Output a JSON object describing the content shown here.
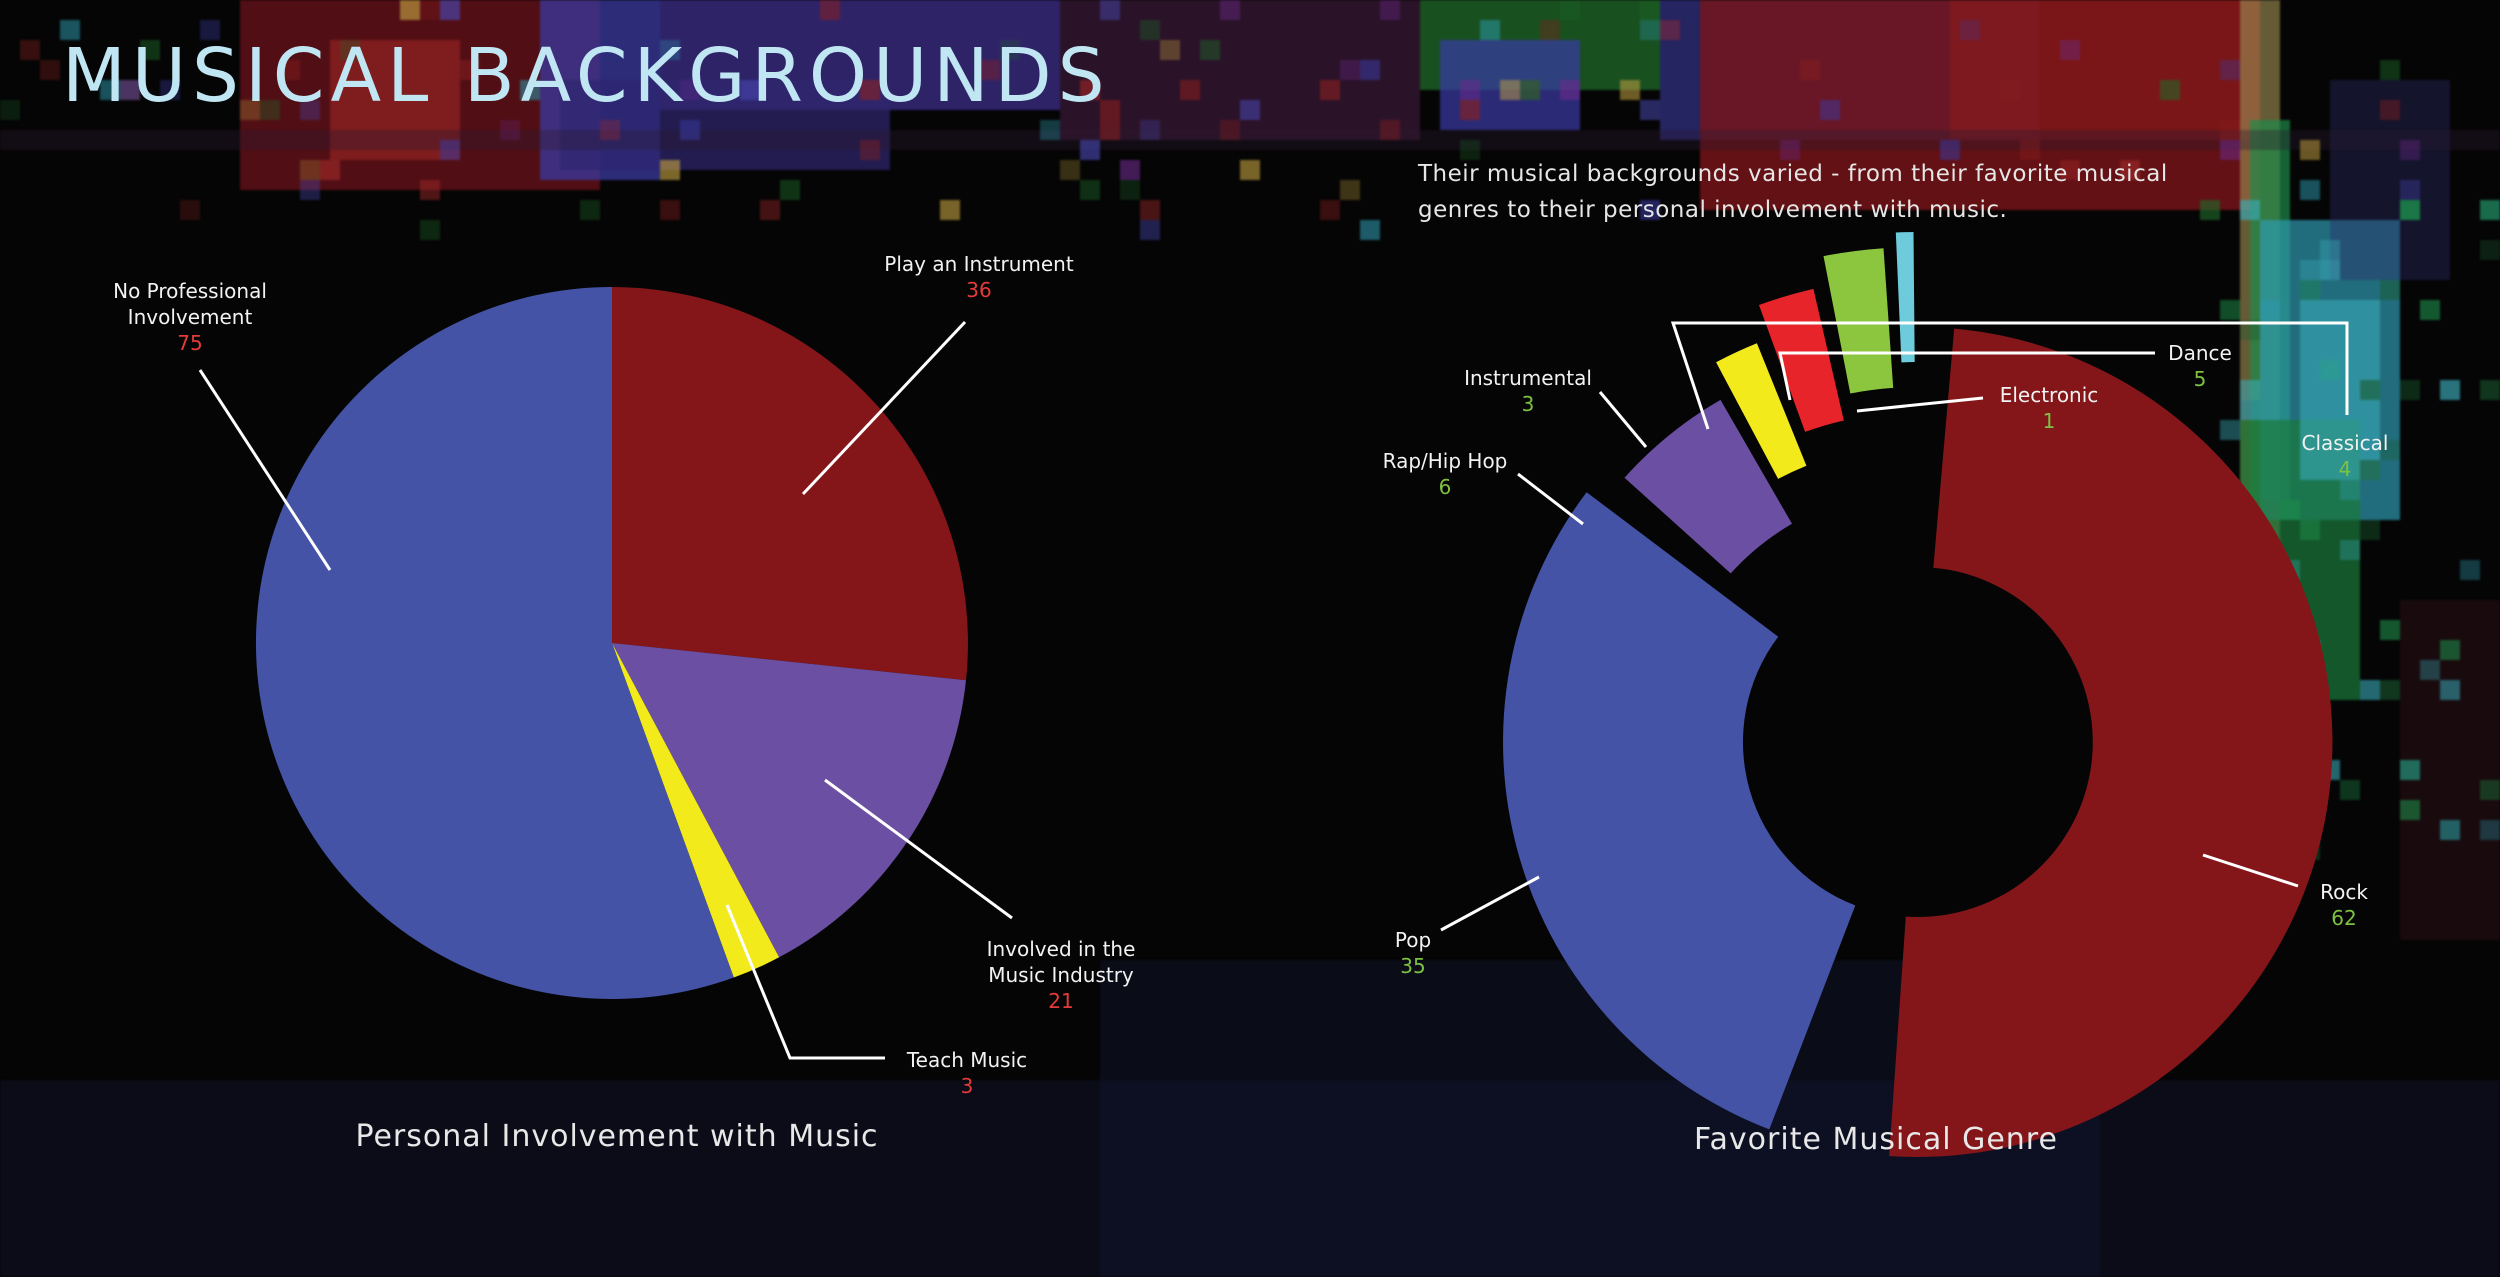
{
  "header": {
    "title": "MUSICAL BACKGROUNDS",
    "intro": "Their musical backgrounds varied - from their favorite musical genres to their personal involvement with music."
  },
  "colors": {
    "background": "#050505",
    "title": "#bfe6f2",
    "value_red": "#e53a3a",
    "value_green": "#7dc142"
  },
  "chart_data": [
    {
      "type": "pie",
      "title": "Personal Involvement with Music",
      "categories": [
        "Play an Instrument",
        "Involved in the Music Industry",
        "Teach Music",
        "No Professional Involvement"
      ],
      "values": [
        36,
        21,
        3,
        75
      ],
      "colors": [
        "#84161a",
        "#6b4fa3",
        "#f3ea1c",
        "#4453a6"
      ]
    },
    {
      "type": "pie",
      "style": "radial bar",
      "title": "Favorite Musical Genre",
      "categories": [
        "Rock",
        "Pop",
        "Rap/Hip Hop",
        "Instrumental",
        "Classical",
        "Dance",
        "Electronic"
      ],
      "values": [
        62,
        35,
        6,
        3,
        4,
        5,
        1
      ],
      "colors": [
        "#84161a",
        "#4453a6",
        "#6b4fa3",
        "#f3ea1c",
        "#e8242b",
        "#8cc63f",
        "#6dcbdb"
      ]
    }
  ]
}
